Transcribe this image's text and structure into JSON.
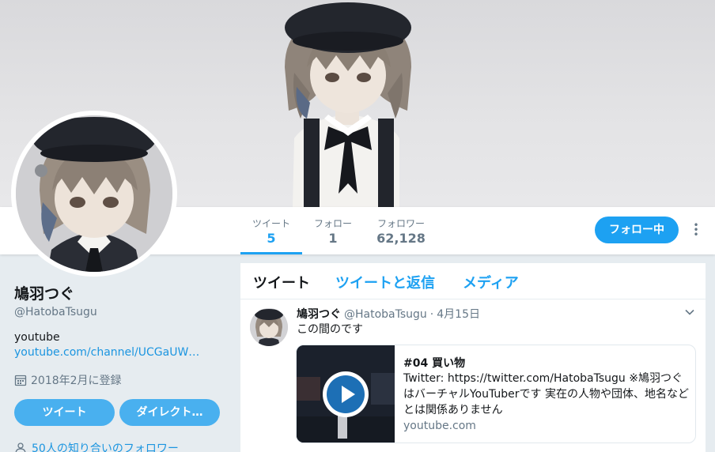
{
  "stats": [
    {
      "label": "ツイート",
      "value": "5"
    },
    {
      "label": "フォロー",
      "value": "1"
    },
    {
      "label": "フォロワー",
      "value": "62,128"
    }
  ],
  "follow_button": "フォロー中",
  "profile": {
    "name": "鳩羽つぐ",
    "handle": "@HatobaTsugu",
    "bio": "youtube",
    "url": "youtube.com/channel/UCGaUW…",
    "joined": "2018年2月に登録",
    "tweet_button": "ツイート",
    "dm_button": "ダイレクト…",
    "followers_you_know": "50人の知り合いのフォロワー"
  },
  "tabs": [
    "ツイート",
    "ツイートと返信",
    "メディア"
  ],
  "tweet": {
    "name": "鳩羽つぐ",
    "handle": "@HatobaTsugu",
    "separator": "·",
    "date": "4月15日",
    "text": "この間のです",
    "card": {
      "title": "#04 買い物",
      "description": "Twitter: https://twitter.com/HatobaTsugu ※鳩羽つぐはバーチャルYouTuberです 実在の人物や団体、地名などとは関係ありません",
      "domain": "youtube.com"
    }
  },
  "colors": {
    "accent": "#1da1f2",
    "background": "#e6ecf0",
    "secondary_text": "#657786"
  }
}
